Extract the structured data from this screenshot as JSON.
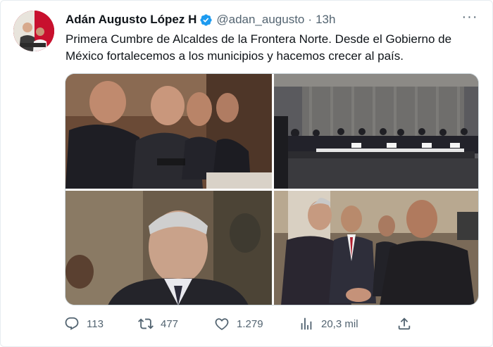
{
  "tweet": {
    "author_name": "Adán Augusto López H",
    "handle": "@adan_augusto",
    "separator": "·",
    "time": "13h",
    "text": "Primera Cumbre de Alcaldes de la Frontera Norte. Desde el Gobierno de México fortalecemos a los municipios y hacemos crecer al país.",
    "verified_color": "#1d9bf0",
    "more_label": "···"
  },
  "media": [
    {
      "icon": "photo-officials-seated"
    },
    {
      "icon": "photo-meeting-room"
    },
    {
      "icon": "photo-portrait"
    },
    {
      "icon": "photo-handshake"
    }
  ],
  "actions": {
    "replies": "113",
    "retweets": "477",
    "likes": "1.279",
    "views": "20,3 mil"
  },
  "colors": {
    "text": "#0f1419",
    "secondary": "#536471",
    "accent": "#1d9bf0"
  }
}
